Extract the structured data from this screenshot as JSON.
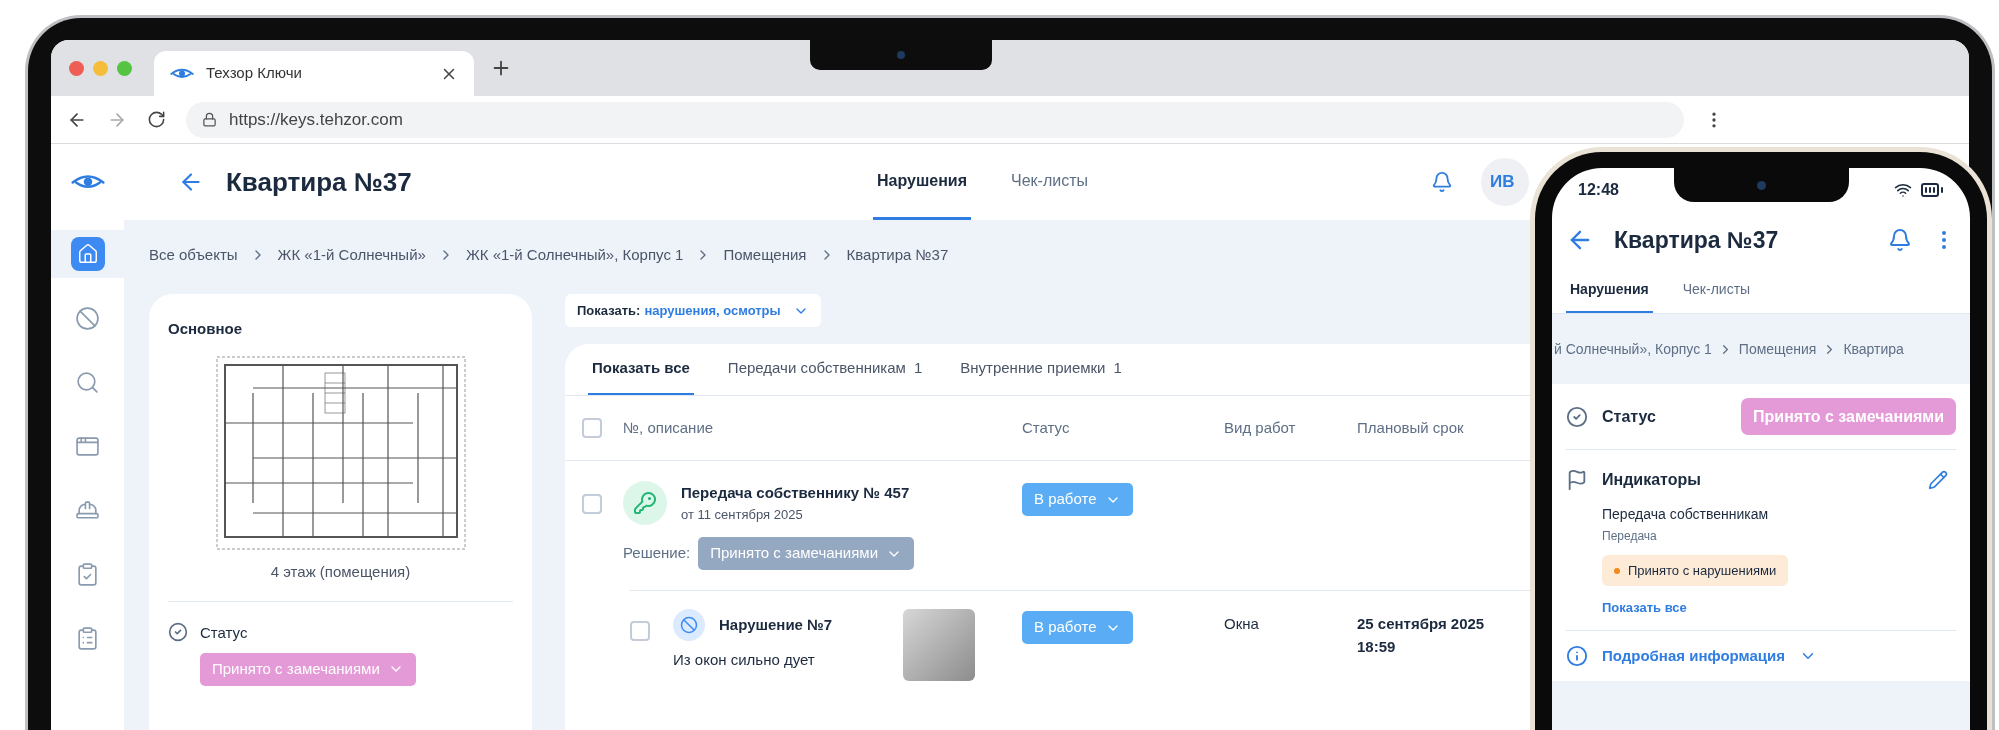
{
  "browser": {
    "tab_title": "Техзор Ключи",
    "url": "https://keys.tehzor.com"
  },
  "header": {
    "title": "Квартира №37",
    "avatar": "ИВ",
    "tabs": [
      {
        "label": "Нарушения",
        "selected": true
      },
      {
        "label": "Чек-листы",
        "selected": false
      }
    ]
  },
  "sidebar": {
    "items": [
      {
        "kind": "home",
        "selected": true
      },
      {
        "kind": "violations",
        "selected": false
      },
      {
        "kind": "search",
        "selected": false
      },
      {
        "kind": "documents",
        "selected": false
      },
      {
        "kind": "construction",
        "selected": false
      },
      {
        "kind": "checklist",
        "selected": false
      },
      {
        "kind": "tasks",
        "selected": false
      }
    ]
  },
  "breadcrumbs": [
    "Все объекты",
    "ЖК «1-й Солнечный»",
    "ЖК «1-й Солнечный», Корпус 1",
    "Помещения",
    "Квартира №37"
  ],
  "info_card": {
    "title": "Основное",
    "plan_caption": "4 этаж (помещения)",
    "status_label": "Статус",
    "status_value": "Принято с замечаниями"
  },
  "filter": {
    "label": "Показать:",
    "value": "нарушения, осмотры"
  },
  "table": {
    "tabs": [
      {
        "label": "Показать все",
        "selected": true
      },
      {
        "label": "Передачи собственникам",
        "count": "1",
        "selected": false
      },
      {
        "label": "Внутренние приемки",
        "count": "1",
        "selected": false
      }
    ],
    "select_all_checked": false,
    "columns": [
      "№, описание",
      "Статус",
      "Вид работ",
      "Плановый срок"
    ],
    "rows": [
      {
        "kind": "transfer",
        "checked": false,
        "title": "Передача собственнику № 457",
        "subtitle": "от 11 сентября 2025",
        "decision_label": "Решение:",
        "decision_value": "Принято с замечаниями",
        "decision_disabled": true,
        "status": "В работе"
      },
      {
        "kind": "violation",
        "checked": false,
        "title": "Нарушение №7",
        "description": "Из окон сильно дует",
        "status": "В работе",
        "work_type": "Окна",
        "due_date": "25 сентября 2025",
        "due_time": "18:59"
      }
    ]
  },
  "phone": {
    "time": "12:48",
    "title": "Квартира №37",
    "tabs": [
      {
        "label": "Нарушения",
        "selected": true
      },
      {
        "label": "Чек-листы",
        "selected": false
      }
    ],
    "breadcrumbs": [
      "й Солнечный», Корпус 1",
      "Помещения",
      "Квартира"
    ],
    "status_label": "Статус",
    "status_value": "Принято с замечаниями",
    "indicators_label": "Индикаторы",
    "indicator_title": "Передача собственникам",
    "indicator_subtitle": "Передача",
    "indicator_badge": "Принято с нарушениями",
    "show_all": "Показать все",
    "details": "Подробная информация"
  }
}
